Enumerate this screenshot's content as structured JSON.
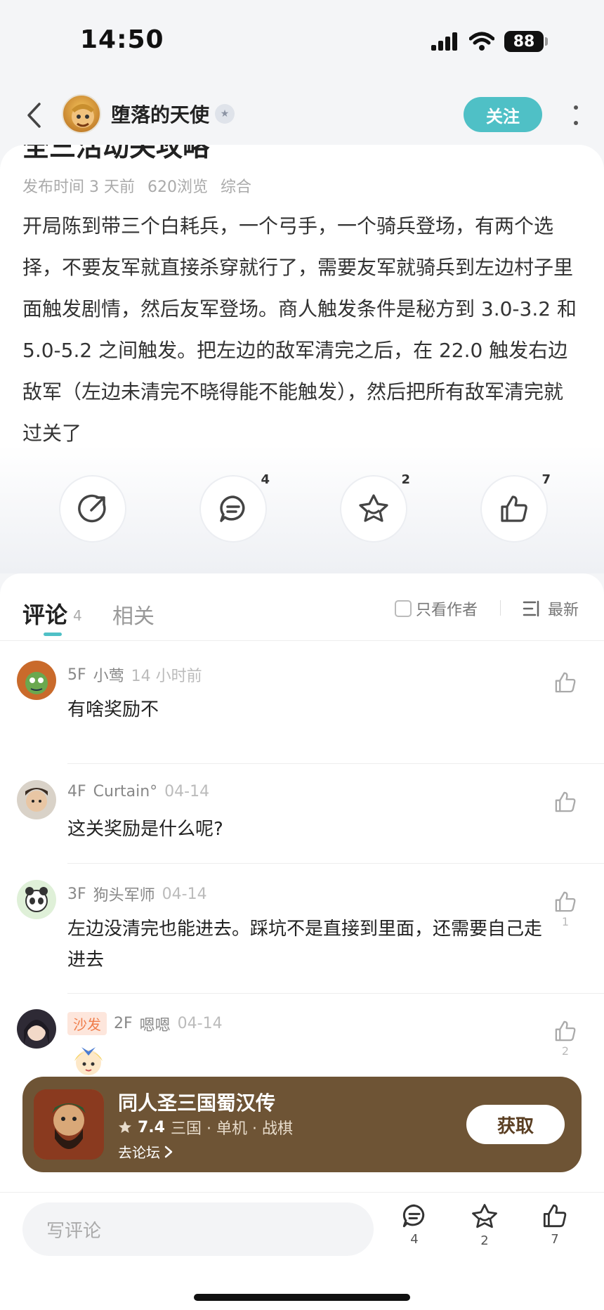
{
  "status": {
    "time": "14:50",
    "battery": "88"
  },
  "nav": {
    "author_name": "堕落的天使",
    "follow_label": "关注"
  },
  "article": {
    "title_fragment": "全三活动关攻略",
    "meta": {
      "published": "发布时间 3 天前",
      "views": "620浏览",
      "category": "综合"
    },
    "body": "开局陈到带三个白耗兵，一个弓手，一个骑兵登场，有两个选择，不要友军就直接杀穿就行了，需要友军就骑兵到左边村子里面触发剧情，然后友军登场。商人触发条件是秘方到 3.0-3.2 和 5.0-5.2 之间触发。把左边的敌军清完之后，在 22.0 触发右边敌军（左边未清完不晓得能不能触发），然后把所有敌军清完就过关了"
  },
  "actions": {
    "share_icon": "share-icon",
    "comment_count": "4",
    "favorite_count": "2",
    "like_count": "7"
  },
  "tabs": {
    "comments_label": "评论",
    "comments_count": "4",
    "related_label": "相关",
    "only_author_label": "只看作者",
    "sort_label": "最新"
  },
  "comments": [
    {
      "floor": "5F",
      "user": "小莺",
      "time": "14 小时前",
      "text": "有啥奖励不",
      "likes": ""
    },
    {
      "floor": "4F",
      "user": "Curtain°",
      "time": "04-14",
      "text": "这关奖励是什么呢?",
      "likes": ""
    },
    {
      "floor": "3F",
      "user": "狗头军师",
      "time": "04-14",
      "text": "左边没清完也能进去。踩坑不是直接到里面，还需要自己走进去",
      "likes": "1"
    },
    {
      "floor": "2F",
      "user": "嗯嗯",
      "time": "04-14",
      "text": "",
      "likes": "2",
      "tag": "沙发"
    }
  ],
  "game": {
    "title": "同人圣三国蜀汉传",
    "score": "7.4",
    "tags": "三国 · 单机 · 战棋",
    "forum_link": "去论坛",
    "get_label": "获取"
  },
  "bottom": {
    "input_placeholder": "写评论",
    "comment_count": "4",
    "favorite_count": "2",
    "like_count": "7"
  },
  "colors": {
    "accent": "#4fc0c6",
    "banner": "#6e5435"
  }
}
